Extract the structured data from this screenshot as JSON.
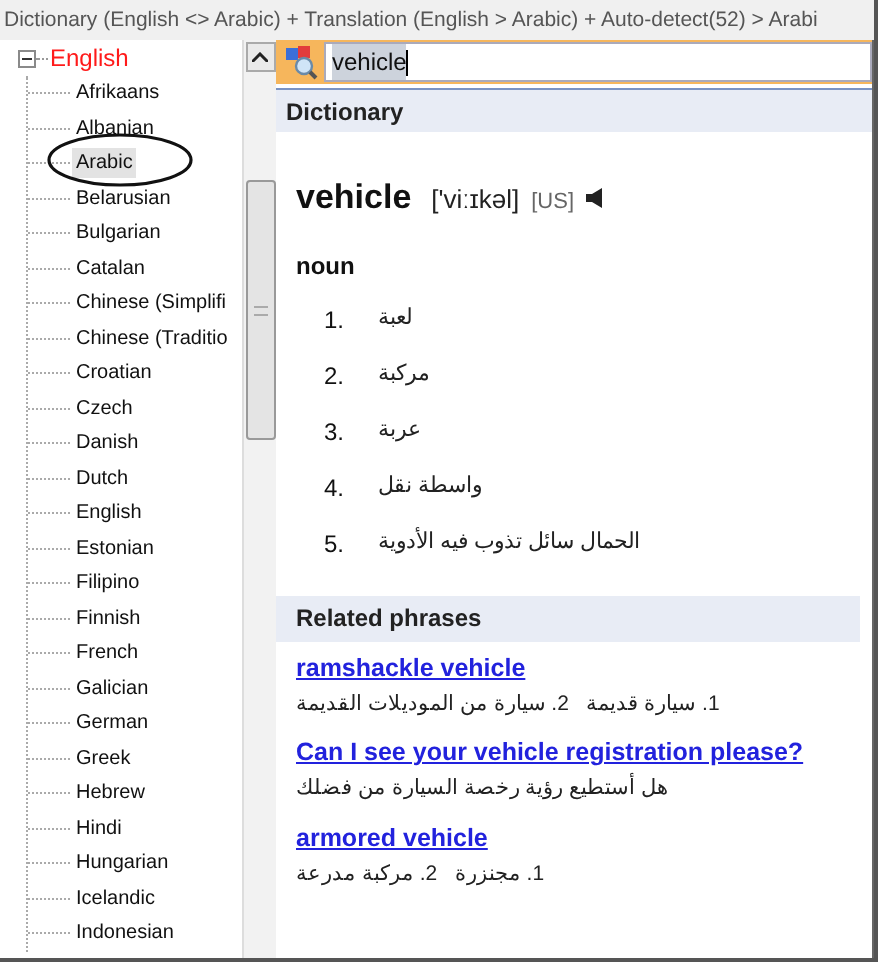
{
  "title_bar": {
    "title": "Dictionary (English <> Arabic) + Translation (English > Arabic) + Auto-detect(52) > Arabi"
  },
  "tree": {
    "root": {
      "label": "English",
      "expanded": true,
      "children": [
        {
          "label": "Afrikaans",
          "selected": false
        },
        {
          "label": "Albanian",
          "selected": false
        },
        {
          "label": "Arabic",
          "selected": true
        },
        {
          "label": "Belarusian",
          "selected": false
        },
        {
          "label": "Bulgarian",
          "selected": false
        },
        {
          "label": "Catalan",
          "selected": false
        },
        {
          "label": "Chinese (Simplifi",
          "selected": false
        },
        {
          "label": "Chinese (Traditio",
          "selected": false
        },
        {
          "label": "Croatian",
          "selected": false
        },
        {
          "label": "Czech",
          "selected": false
        },
        {
          "label": "Danish",
          "selected": false
        },
        {
          "label": "Dutch",
          "selected": false
        },
        {
          "label": "English",
          "selected": false
        },
        {
          "label": "Estonian",
          "selected": false
        },
        {
          "label": "Filipino",
          "selected": false
        },
        {
          "label": "Finnish",
          "selected": false
        },
        {
          "label": "French",
          "selected": false
        },
        {
          "label": "Galician",
          "selected": false
        },
        {
          "label": "German",
          "selected": false
        },
        {
          "label": "Greek",
          "selected": false
        },
        {
          "label": "Hebrew",
          "selected": false
        },
        {
          "label": "Hindi",
          "selected": false
        },
        {
          "label": "Hungarian",
          "selected": false
        },
        {
          "label": "Icelandic",
          "selected": false
        },
        {
          "label": "Indonesian",
          "selected": false
        }
      ]
    }
  },
  "search": {
    "value": "vehicle"
  },
  "dictionary": {
    "header": "Dictionary",
    "headword": "vehicle",
    "phonetic": "['viːɪkəl]",
    "region": "[US]",
    "part_of_speech": "noun",
    "senses": [
      {
        "number": "1.",
        "text": "لعبة"
      },
      {
        "number": "2.",
        "text": "مركبة"
      },
      {
        "number": "3.",
        "text": "عربة"
      },
      {
        "number": "4.",
        "text": "واسطة نقل"
      },
      {
        "number": "5.",
        "text": "الحمال سائل تذوب فيه الأدوية"
      }
    ]
  },
  "related": {
    "header": "Related phrases",
    "phrases": [
      {
        "phrase": "ramshackle vehicle",
        "translation": "1. سيارة قديمة   2. سيارة من الموديلات القديمة"
      },
      {
        "phrase": "Can I see your vehicle registration please?",
        "translation": "هل أستطيع رؤية رخصة السيارة من فضلك"
      },
      {
        "phrase": "armored vehicle",
        "translation": "1. مجنزرة   2. مركبة مدرعة"
      }
    ]
  }
}
